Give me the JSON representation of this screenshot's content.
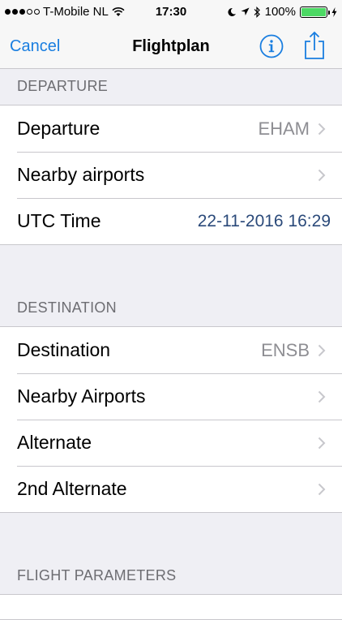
{
  "status_bar": {
    "carrier": "T-Mobile NL",
    "time": "17:30",
    "battery": "100%"
  },
  "navbar": {
    "cancel_label": "Cancel",
    "title": "Flightplan",
    "info_icon": "info-circle-icon",
    "share_icon": "share-icon"
  },
  "sections": {
    "departure": {
      "header": "DEPARTURE",
      "rows": [
        {
          "label": "Departure",
          "value": "EHAM"
        },
        {
          "label": "Nearby airports",
          "value": ""
        },
        {
          "label": "UTC Time",
          "value": "22-11-2016 16:29"
        }
      ]
    },
    "destination": {
      "header": "DESTINATION",
      "rows": [
        {
          "label": "Destination",
          "value": "ENSB"
        },
        {
          "label": "Nearby Airports",
          "value": ""
        },
        {
          "label": "Alternate",
          "value": ""
        },
        {
          "label": "2nd Alternate",
          "value": ""
        }
      ]
    },
    "flight_parameters": {
      "header": "FLIGHT PARAMETERS"
    }
  },
  "colors": {
    "accent": "#1a7ee0",
    "value_gray": "#8e8e93",
    "time_value": "#2b4a7a",
    "battery": "#4cd964"
  }
}
